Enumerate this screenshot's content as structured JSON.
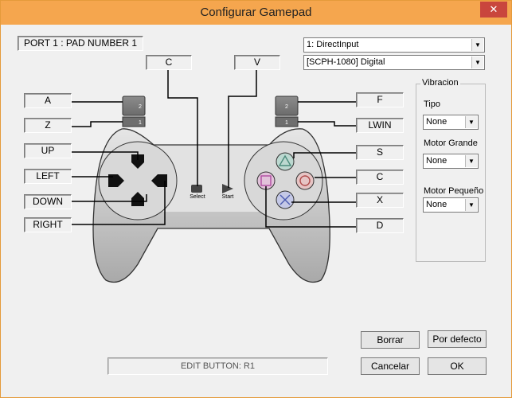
{
  "window": {
    "title": "Configurar Gamepad",
    "close_glyph": "✕"
  },
  "port_label": "PORT 1 : PAD NUMBER 1",
  "mapping": {
    "c": "C",
    "v": "V",
    "a": "A",
    "z": "Z",
    "up": "UP",
    "left": "LEFT",
    "down": "DOWN",
    "right": "RIGHT",
    "f": "F",
    "lwin": "LWIN",
    "s": "S",
    "c2": "C",
    "x": "X",
    "d": "D"
  },
  "pad_labels": {
    "select": "Select",
    "start": "Start",
    "l2": "2",
    "l1": "1",
    "r2": "2",
    "r1": "1"
  },
  "input_api": {
    "value": "1: DirectInput"
  },
  "device": {
    "value": "[SCPH-1080] Digital"
  },
  "vibration": {
    "title": "Vibracion",
    "tipo_label": "Tipo",
    "tipo_value": "None",
    "motor_grande_label": "Motor Grande",
    "motor_grande_value": "None",
    "motor_pequeno_label": "Motor Pequeño",
    "motor_pequeno_value": "None"
  },
  "edit_status": "EDIT BUTTON: R1",
  "buttons": {
    "borrar": "Borrar",
    "por_defecto": "Por defecto",
    "cancelar": "Cancelar",
    "ok": "OK"
  }
}
